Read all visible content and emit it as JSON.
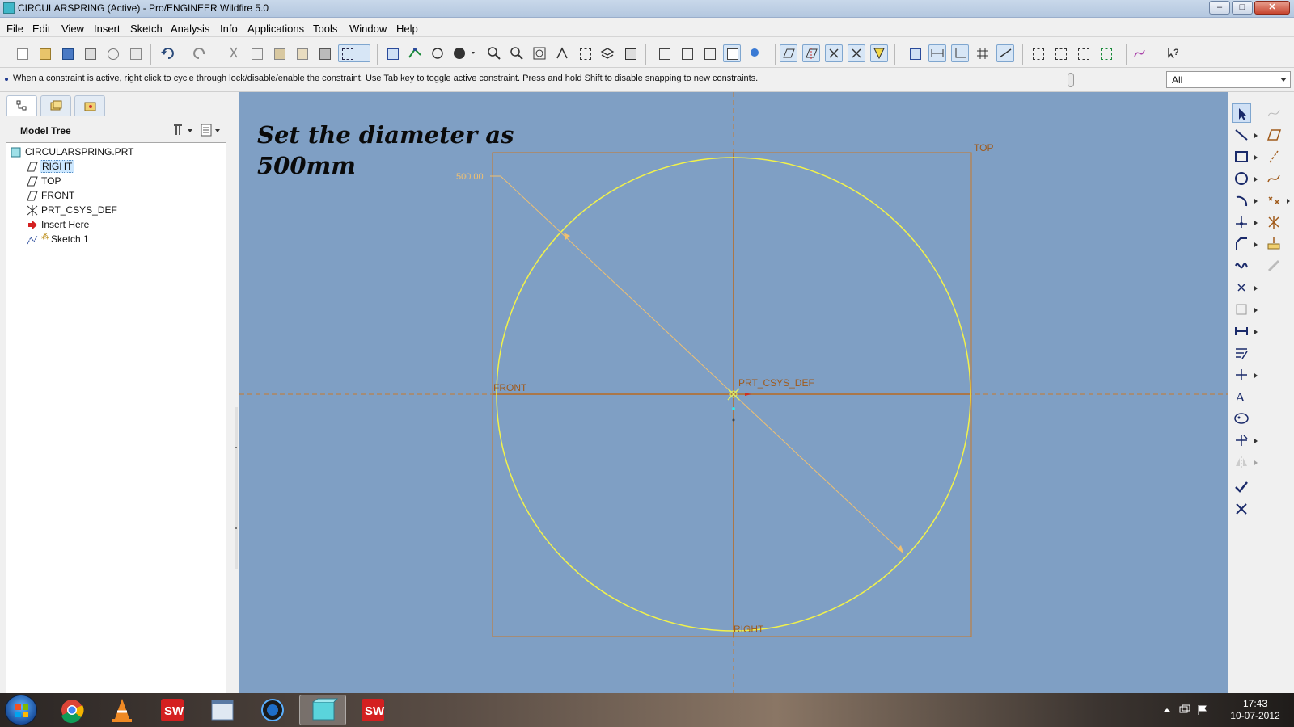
{
  "window": {
    "title": "CIRCULARSPRING (Active) - Pro/ENGINEER Wildfire 5.0",
    "minimize": "–",
    "maximize": "□",
    "close": "✕"
  },
  "menu": [
    "File",
    "Edit",
    "View",
    "Insert",
    "Sketch",
    "Analysis",
    "Info",
    "Applications",
    "Tools",
    "Window",
    "Help"
  ],
  "message": "When a constraint is active, right click to cycle through lock/disable/enable the constraint. Use Tab key to toggle active constraint. Press and hold Shift to disable snapping to new constraints.",
  "filter": {
    "value": "All"
  },
  "panel": {
    "tabs": [
      "model-tree-tab",
      "layers-tab",
      "favorites-tab"
    ],
    "title": "Model Tree",
    "tree": [
      {
        "label": "CIRCULARSPRING.PRT",
        "icon": "part-icon",
        "level": 0
      },
      {
        "label": "RIGHT",
        "icon": "datum-plane-icon",
        "level": 1,
        "selected": true
      },
      {
        "label": "TOP",
        "icon": "datum-plane-icon",
        "level": 1
      },
      {
        "label": "FRONT",
        "icon": "datum-plane-icon",
        "level": 1
      },
      {
        "label": "PRT_CSYS_DEF",
        "icon": "csys-icon",
        "level": 1
      },
      {
        "label": "Insert Here",
        "icon": "insert-arrow-icon",
        "level": 1
      },
      {
        "label": "Sketch 1",
        "icon": "sketch-icon",
        "level": 1
      }
    ]
  },
  "canvas": {
    "annotation_line1": "Set the diameter as",
    "annotation_line2": "500mm",
    "dimension": "500.00",
    "labels": {
      "top": "TOP",
      "front": "FRONT",
      "right": "RIGHT",
      "csys": "PRT_CSYS_DEF"
    },
    "colors": {
      "background": "#7f9fc4",
      "circle": "#f2f24a",
      "datum": "#c8782a",
      "dimension": "#f0c070",
      "annotation": "#0a0a0a"
    }
  },
  "taskbar": {
    "time": "17:43",
    "date": "10-07-2012",
    "apps": [
      "chrome-icon",
      "vlc-icon",
      "solidworks-icon",
      "explorer-window-icon",
      "media-icon",
      "proe-icon",
      "solidworks-icon"
    ]
  }
}
